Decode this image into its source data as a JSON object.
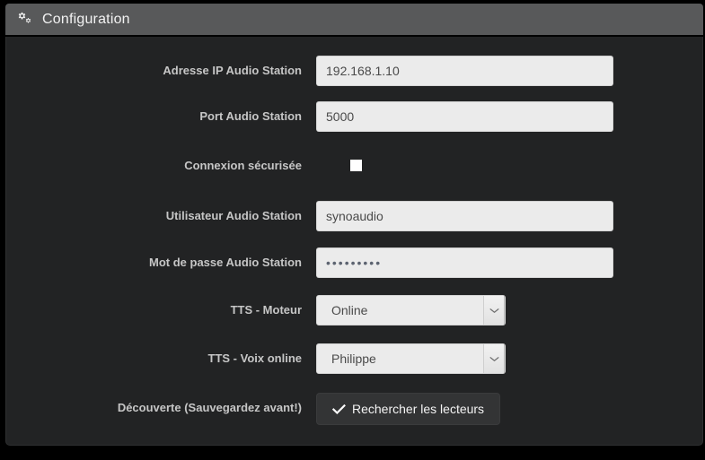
{
  "header": {
    "icon": "cogs-icon",
    "title": "Configuration"
  },
  "form": {
    "rows": [
      {
        "id": "audio-station-ip",
        "label": "Adresse IP Audio Station",
        "type": "text",
        "value": "192.168.1.10"
      },
      {
        "id": "audio-station-port",
        "label": "Port Audio Station",
        "type": "text",
        "value": "5000"
      },
      {
        "id": "secure-connection",
        "label": "Connexion sécurisée",
        "type": "checkbox",
        "checked": false
      },
      {
        "id": "audio-station-user",
        "label": "Utilisateur Audio Station",
        "type": "text",
        "value": "synoaudio"
      },
      {
        "id": "audio-station-password",
        "label": "Mot de passe Audio Station",
        "type": "password",
        "value": "•••••••••"
      },
      {
        "id": "tts-engine",
        "label": "TTS - Moteur",
        "type": "select",
        "value": "Online",
        "arrow_icon": "chevron-down-icon"
      },
      {
        "id": "tts-online-voice",
        "label": "TTS - Voix online",
        "type": "select",
        "value": "Philippe",
        "arrow_icon": "chevron-down-icon"
      },
      {
        "id": "discovery",
        "label": "Découverte (Sauvegardez avant!)",
        "type": "button",
        "button_label": "Rechercher les lecteurs",
        "button_icon": "check-icon"
      }
    ]
  },
  "colors": {
    "header_bg": "#58595a",
    "body_bg": "#222324",
    "label_text": "#c6c6c6",
    "input_bg": "#ebebeb",
    "input_text": "#4a4a4a",
    "button_bg": "#333435",
    "button_text": "#f4f4f4"
  }
}
